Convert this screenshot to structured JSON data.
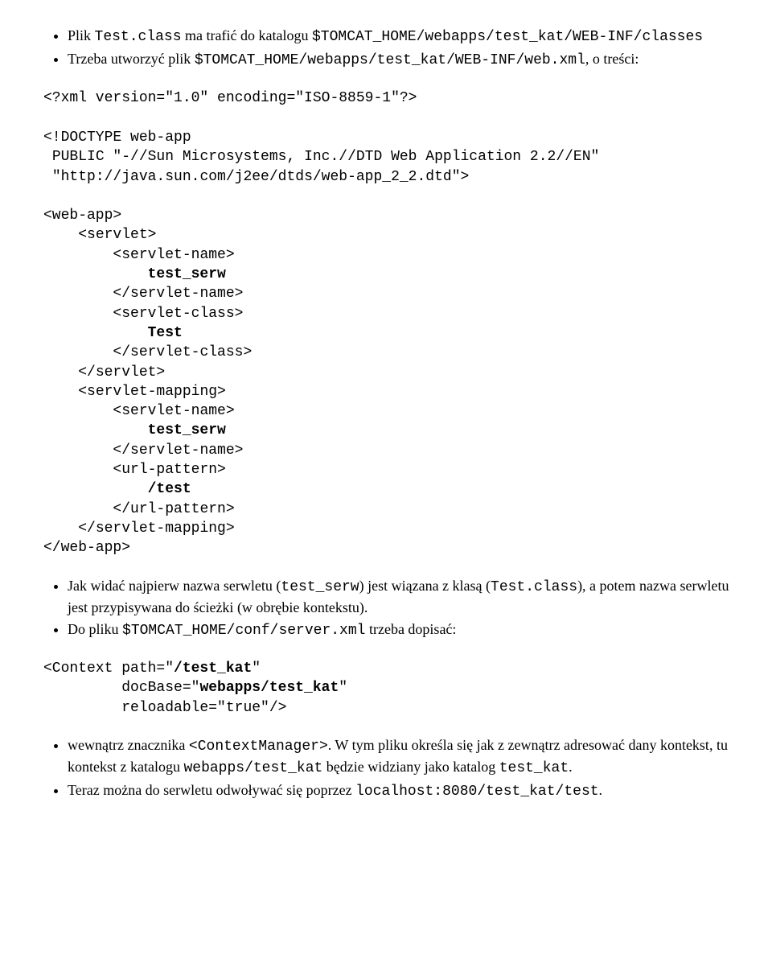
{
  "bullets1": {
    "item1_prefix_serif": "Plik ",
    "item1_mono1": "Test.class",
    "item1_serif1": " ma trafić do katalogu ",
    "item1_mono2": "$TOMCAT_HOME/webapps/test_kat/WEB-INF/classes",
    "item2_serif1": "Trzeba utworzyć plik ",
    "item2_mono1": "$TOMCAT_HOME/webapps/test_kat/WEB-INF/web.xml",
    "item2_serif2": ", o treści:"
  },
  "code1": {
    "line1": "<?xml version=\"1.0\" encoding=\"ISO-8859-1\"?>",
    "line2": "",
    "line3": "<!DOCTYPE web-app",
    "line4": " PUBLIC \"-//Sun Microsystems, Inc.//DTD Web Application 2.2//EN\"",
    "line5": " \"http://java.sun.com/j2ee/dtds/web-app_2_2.dtd\">",
    "line6": "",
    "line7": "<web-app>",
    "line8": "    <servlet>",
    "line9": "        <servlet-name>",
    "line10a": "            ",
    "line10b": "test_serw",
    "line11": "        </servlet-name>",
    "line12": "        <servlet-class>",
    "line13a": "            ",
    "line13b": "Test",
    "line14": "        </servlet-class>",
    "line15": "    </servlet>",
    "line16": "    <servlet-mapping>",
    "line17": "        <servlet-name>",
    "line18a": "            ",
    "line18b": "test_serw",
    "line19": "        </servlet-name>",
    "line20": "        <url-pattern>",
    "line21a": "            ",
    "line21b": "/test",
    "line22": "        </url-pattern>",
    "line23": "    </servlet-mapping>",
    "line24": "</web-app>"
  },
  "bullets2": {
    "item1_s1": "Jak widać najpierw nazwa serwletu (",
    "item1_m1": "test_serw",
    "item1_s2": ") jest wiązana z klasą (",
    "item1_m2": "Test.class",
    "item1_s3": "), a potem nazwa serwletu jest przypisywana do ścieżki (w obrębie kontekstu).",
    "item2_s1": "Do pliku ",
    "item2_m1": "$TOMCAT_HOME/conf/server.xml",
    "item2_s2": " trzeba dopisać:"
  },
  "code2": {
    "l1a": "<Context path=\"",
    "l1b": "/test_kat",
    "l1c": "\"",
    "l2a": "         docBase=\"",
    "l2b": "webapps/test_kat",
    "l2c": "\"",
    "l3": "         reloadable=\"true\"/>"
  },
  "bullets3": {
    "item1_s1": "wewnątrz znacznika ",
    "item1_m1": "<ContextManager>",
    "item1_s2": ". W tym pliku określa się jak z zewnątrz adresować dany kontekst, tu kontekst z katalogu ",
    "item1_m2": "webapps/test_kat",
    "item1_s3": " będzie widziany jako katalog ",
    "item1_m3": "test_kat",
    "item1_s4": ".",
    "item2_s1": "Teraz można do serwletu odwoływać się poprzez ",
    "item2_m1": "localhost:8080/test_kat/test",
    "item2_s2": "."
  }
}
